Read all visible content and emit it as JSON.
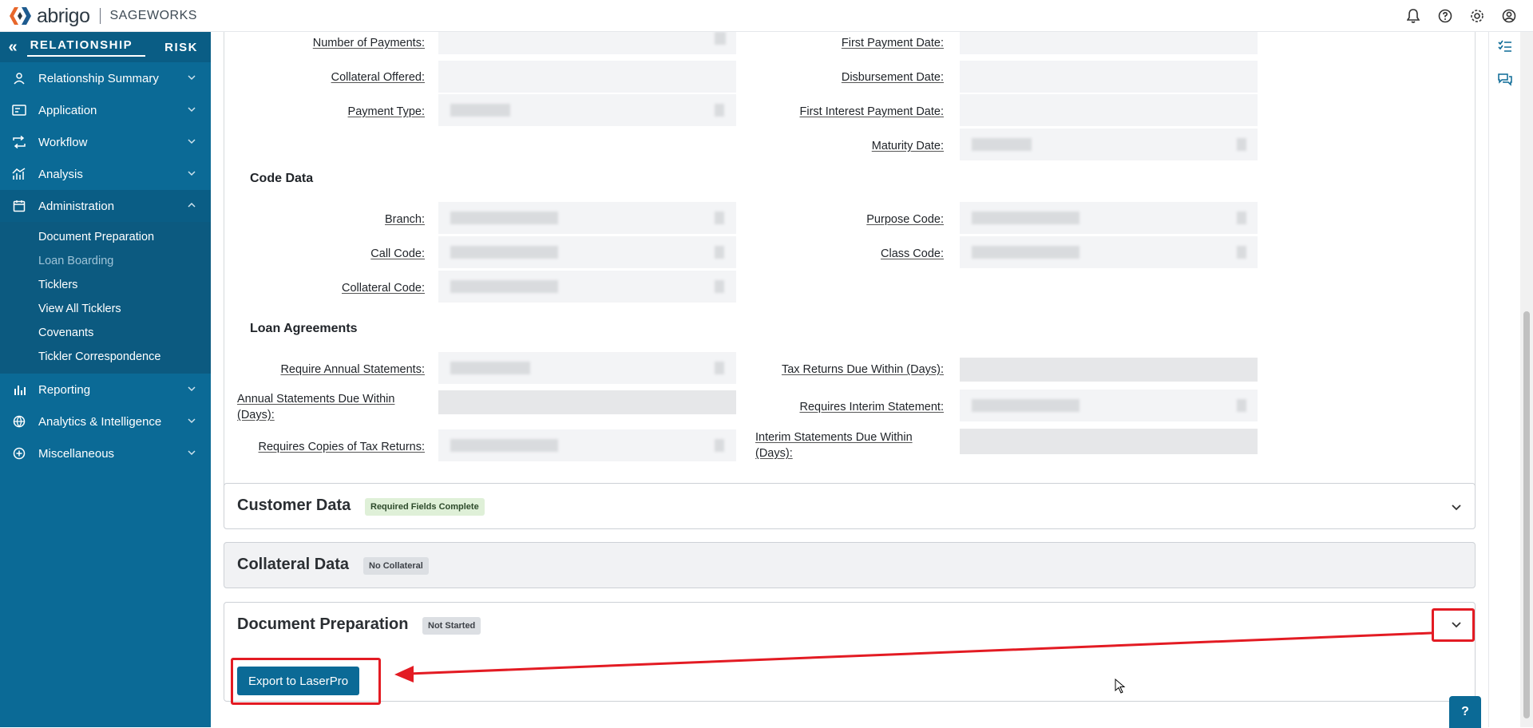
{
  "app": {
    "brand": "abrigo",
    "product": "SAGEWORKS"
  },
  "sidebar": {
    "tabs": [
      {
        "label": "RELATIONSHIP"
      },
      {
        "label": "RISK"
      }
    ],
    "items": [
      {
        "label": "Relationship Summary"
      },
      {
        "label": "Application"
      },
      {
        "label": "Workflow"
      },
      {
        "label": "Analysis"
      },
      {
        "label": "Administration"
      },
      {
        "label": "Reporting"
      },
      {
        "label": "Analytics & Intelligence"
      },
      {
        "label": "Miscellaneous"
      }
    ],
    "admin_sub": [
      {
        "label": "Document Preparation"
      },
      {
        "label": "Loan Boarding"
      },
      {
        "label": "Ticklers"
      },
      {
        "label": "View All Ticklers"
      },
      {
        "label": "Covenants"
      },
      {
        "label": "Tickler Correspondence"
      }
    ]
  },
  "form": {
    "number_of_payments": "Number of Payments:",
    "collateral_offered": "Collateral Offered:",
    "payment_type": "Payment Type:",
    "first_payment_date": "First Payment Date:",
    "disbursement_date": "Disbursement Date:",
    "first_interest_payment_date": "First Interest Payment Date:",
    "maturity_date": "Maturity Date:",
    "code_data_title": "Code Data",
    "branch": "Branch:",
    "call_code": "Call Code:",
    "collateral_code": "Collateral Code:",
    "purpose_code": "Purpose Code:",
    "class_code": "Class Code:",
    "loan_agreements_title": "Loan Agreements",
    "require_annual_statements": "Require Annual Statements:",
    "annual_statements_due": "Annual Statements Due Within (Days):",
    "requires_copies_tax_returns": "Requires Copies of Tax Returns:",
    "tax_returns_due": "Tax Returns Due Within (Days):",
    "requires_interim_statement": "Requires Interim Statement:",
    "interim_statements_due": "Interim Statements Due Within (Days):"
  },
  "panels": {
    "customer": {
      "title": "Customer Data",
      "badge": "Required Fields Complete"
    },
    "collateral": {
      "title": "Collateral Data",
      "badge": "No Collateral"
    },
    "docprep": {
      "title": "Document Preparation",
      "badge": "Not Started",
      "export_label": "Export to LaserPro"
    }
  },
  "help": {
    "label": "?"
  },
  "colors": {
    "sidebar": "#0b6a96",
    "accent_red": "#e31b23",
    "badge_green": "#dff0d8",
    "badge_gray": "#dcdfe3"
  }
}
